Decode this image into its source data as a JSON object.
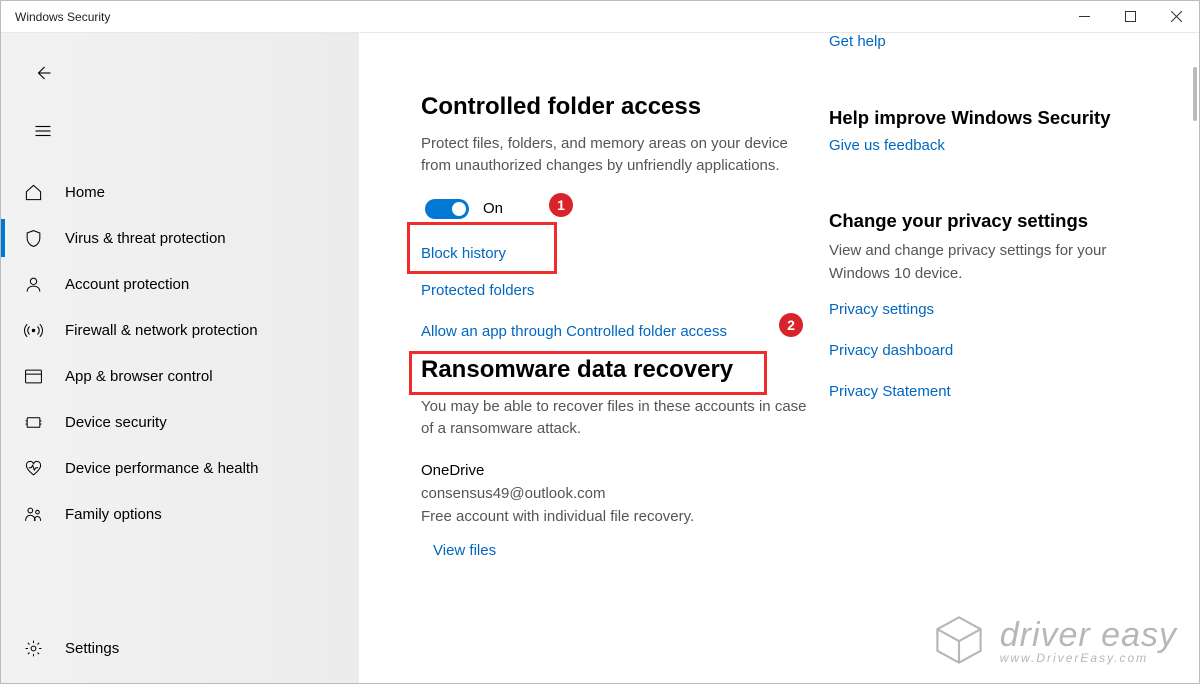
{
  "window": {
    "title": "Windows Security"
  },
  "sidebar": {
    "items": [
      {
        "label": "Home"
      },
      {
        "label": "Virus & threat protection"
      },
      {
        "label": "Account protection"
      },
      {
        "label": "Firewall & network protection"
      },
      {
        "label": "App & browser control"
      },
      {
        "label": "Device security"
      },
      {
        "label": "Device performance & health"
      },
      {
        "label": "Family options"
      }
    ],
    "settings_label": "Settings"
  },
  "main": {
    "heading": "Controlled folder access",
    "description": "Protect files, folders, and memory areas on your device from unauthorized changes by unfriendly applications.",
    "toggle_label": "On",
    "links": {
      "block_history": "Block history",
      "protected_folders": "Protected folders",
      "allow_app": "Allow an app through Controlled folder access"
    },
    "recovery_heading": "Ransomware data recovery",
    "recovery_desc": "You may be able to recover files in these accounts in case of a ransomware attack.",
    "account": {
      "service": "OneDrive",
      "email": "consensus49@outlook.com",
      "plan": "Free account with individual file recovery."
    },
    "view_files": "View files"
  },
  "aside": {
    "get_help": "Get help",
    "improve_heading": "Help improve Windows Security",
    "feedback_link": "Give us feedback",
    "privacy_heading": "Change your privacy settings",
    "privacy_desc": "View and change privacy settings for your Windows 10 device.",
    "privacy_links": {
      "settings": "Privacy settings",
      "dashboard": "Privacy dashboard",
      "statement": "Privacy Statement"
    }
  },
  "annotations": {
    "badge1": "1",
    "badge2": "2"
  },
  "watermark": {
    "line1": "driver easy",
    "line2": "www.DriverEasy.com"
  }
}
